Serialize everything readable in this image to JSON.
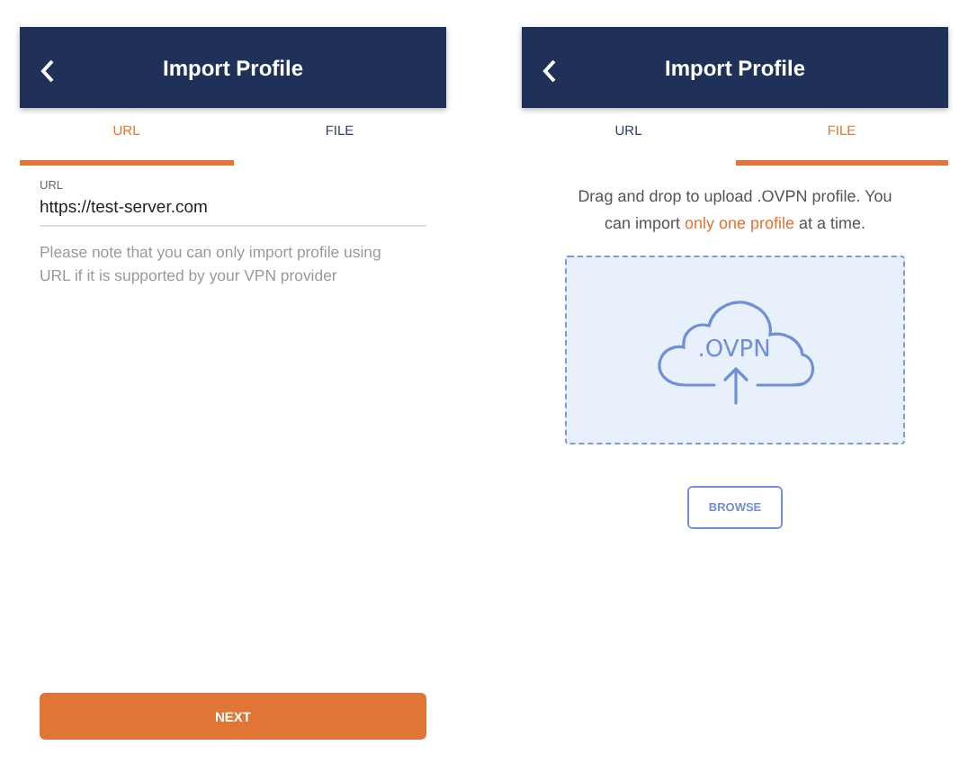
{
  "screens": [
    {
      "title": "Import Profile",
      "tabs": [
        {
          "label": "URL",
          "selected": true
        },
        {
          "label": "FILE",
          "selected": false
        }
      ],
      "content": {
        "kind": "url",
        "field_label": "URL",
        "value": "https://test-server.com",
        "note": "Please note that you can only import profile using URL if it is supported by your VPN provider",
        "button": "NEXT"
      }
    },
    {
      "title": "Import Profile",
      "tabs": [
        {
          "label": "URL",
          "selected": false
        },
        {
          "label": "FILE",
          "selected": true
        }
      ],
      "content": {
        "kind": "file",
        "instructions": [
          {
            "kind": "plain",
            "text": "Drag and drop to upload .OVPN profile. You can import "
          },
          {
            "kind": "highlight",
            "text": "only one profile"
          },
          {
            "kind": "plain",
            "text": " at a time."
          }
        ],
        "cloud_label": ".OVPN",
        "button": "BROWSE"
      }
    }
  ]
}
